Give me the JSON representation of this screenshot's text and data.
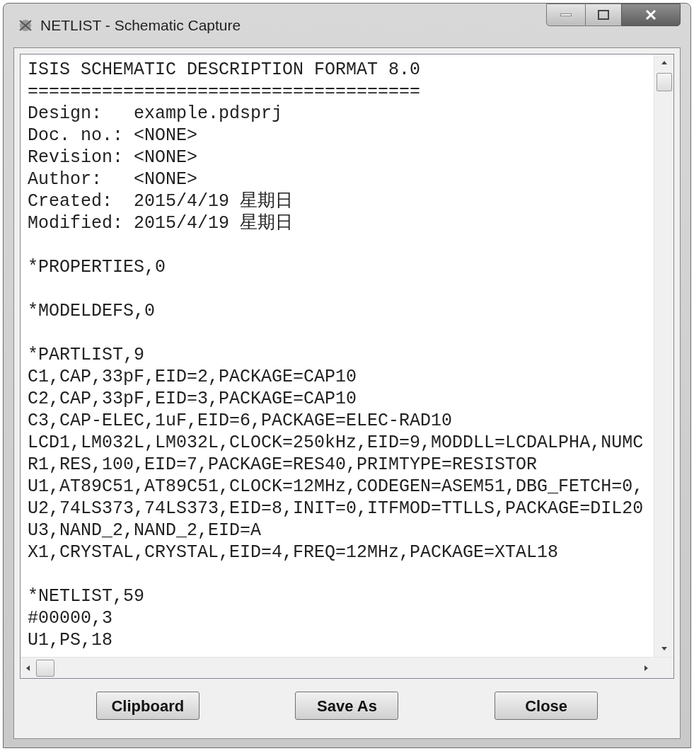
{
  "window": {
    "title": "NETLIST - Schematic Capture"
  },
  "text_blocks": [
    [
      "ISIS SCHEMATIC DESCRIPTION FORMAT 8.0",
      "=====================================",
      "Design:   example.pdsprj",
      "Doc. no.: <NONE>",
      "Revision: <NONE>",
      "Author:   <NONE>",
      "Created:  2015/4/19 星期日",
      "Modified: 2015/4/19 星期日"
    ],
    [
      "*PROPERTIES,0"
    ],
    [
      "*MODELDEFS,0"
    ],
    [
      "*PARTLIST,9",
      "C1,CAP,33pF,EID=2,PACKAGE=CAP10",
      "C2,CAP,33pF,EID=3,PACKAGE=CAP10",
      "C3,CAP-ELEC,1uF,EID=6,PACKAGE=ELEC-RAD10",
      "LCD1,LM032L,LM032L,CLOCK=250kHz,EID=9,MODDLL=LCDALPHA,NUMC",
      "R1,RES,100,EID=7,PACKAGE=RES40,PRIMTYPE=RESISTOR",
      "U1,AT89C51,AT89C51,CLOCK=12MHz,CODEGEN=ASEM51,DBG_FETCH=0,",
      "U2,74LS373,74LS373,EID=8,INIT=0,ITFMOD=TTLLS,PACKAGE=DIL20",
      "U3,NAND_2,NAND_2,EID=A",
      "X1,CRYSTAL,CRYSTAL,EID=4,FREQ=12MHz,PACKAGE=XTAL18"
    ],
    [
      "*NETLIST,59",
      "#00000,3",
      "U1,PS,18"
    ]
  ],
  "buttons": [
    "Clipboard",
    "Save As",
    "Close"
  ]
}
